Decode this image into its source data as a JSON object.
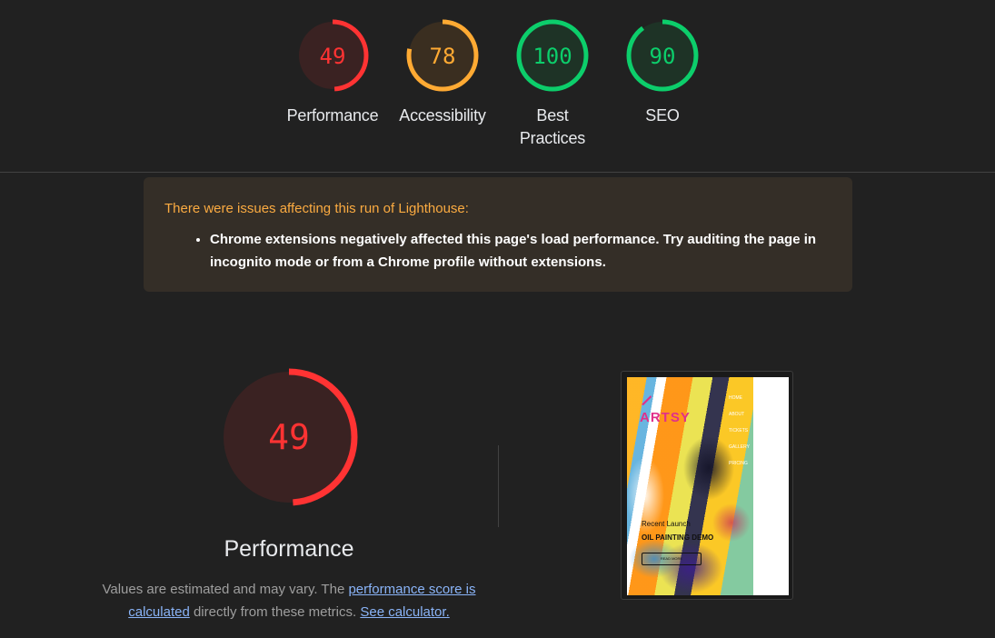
{
  "colors": {
    "fail": "#ff3333",
    "fail_bg": "#3a2222",
    "average": "#ffaa33",
    "average_bg": "#3a2e20",
    "pass": "#0cce6b",
    "pass_bg": "#1e3326"
  },
  "gauges": [
    {
      "score": "49",
      "value": 49,
      "label": "Performance",
      "rating": "fail"
    },
    {
      "score": "78",
      "value": 78,
      "label": "Accessibility",
      "rating": "average"
    },
    {
      "score": "100",
      "value": 100,
      "label": "Best Practices",
      "rating": "pass"
    },
    {
      "score": "90",
      "value": 90,
      "label": "SEO",
      "rating": "pass"
    }
  ],
  "warning": {
    "title": "There were issues affecting this run of Lighthouse:",
    "items": [
      "Chrome extensions negatively affected this page's load performance. Try auditing the page in incognito mode or from a Chrome profile without extensions."
    ]
  },
  "performance": {
    "score": "49",
    "value": 49,
    "title": "Performance",
    "desc_part1": "Values are estimated and may vary. The ",
    "link1": "performance score is calculated",
    "desc_part2": " directly from these metrics. ",
    "link2": "See calculator."
  },
  "screenshot": {
    "logo": "ARTSY",
    "nav": [
      "HOME",
      "ABOUT",
      "TICKETS",
      "GALLERY",
      "PRICING"
    ],
    "subtitle": "Recent Launch",
    "heading": "OIL PAINTING DEMO",
    "button": "READ MORE"
  }
}
